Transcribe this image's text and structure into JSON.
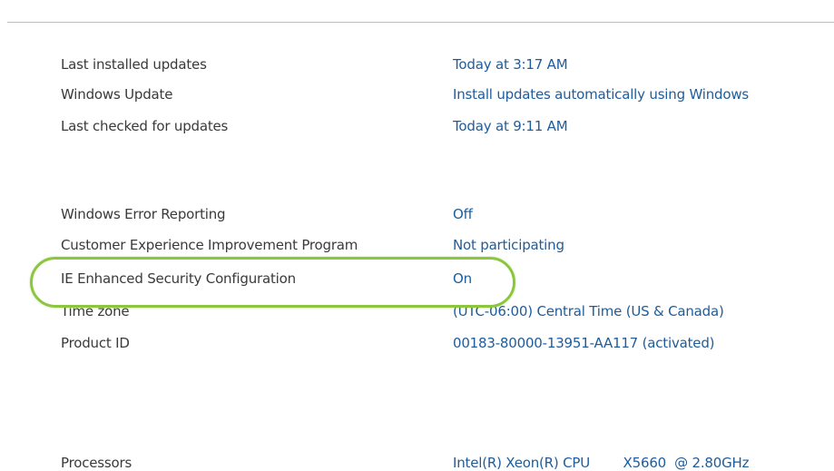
{
  "properties": [
    {
      "label": "Last installed updates",
      "value": "Today at 3:17 AM"
    },
    {
      "label": "Windows Update",
      "value": "Install updates automatically using Windows"
    },
    {
      "label": "Last checked for updates",
      "value": "Today at 9:11 AM"
    },
    {
      "label": "Windows Error Reporting",
      "value": "Off"
    },
    {
      "label": "Customer Experience Improvement Program",
      "value": "Not participating"
    },
    {
      "label": "IE Enhanced Security Configuration",
      "value": "On"
    },
    {
      "label": "Time zone",
      "value": "(UTC-06:00) Central Time (US & Canada)"
    },
    {
      "label": "Product ID",
      "value": "00183-80000-13951-AA117 (activated)"
    },
    {
      "label": "Processors",
      "value": "Intel(R) Xeon(R) CPU        X5660  @ 2.80GHz"
    }
  ],
  "colors": {
    "label_text": "#3a3a3a",
    "link_text": "#1e5c9b",
    "highlight_ring": "#8cc63f",
    "divider": "#bdbdbd"
  }
}
